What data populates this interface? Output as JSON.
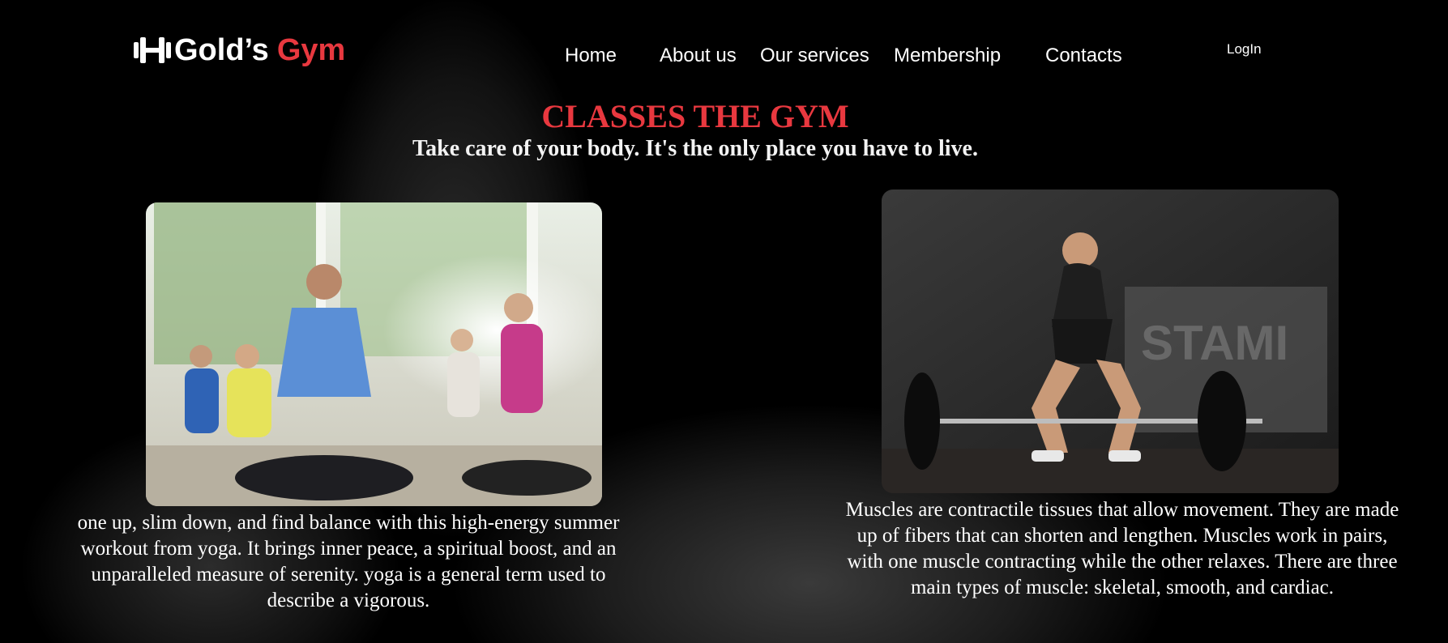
{
  "brand": {
    "name_part1": "Gold’s",
    "name_part2": "Gym",
    "icon": "dumbbell-icon",
    "accent_color": "#e8383f"
  },
  "nav": {
    "items": [
      {
        "label": "Home"
      },
      {
        "label": "About us"
      },
      {
        "label": "Our services"
      },
      {
        "label": "Membership"
      },
      {
        "label": "Contacts"
      }
    ],
    "login_label": "LogIn"
  },
  "hero": {
    "title": "CLASSES THE GYM",
    "subtitle": "Take care of your body. It's the only place you have to live."
  },
  "cards": [
    {
      "image": "yoga-class-photo",
      "text": "one up, slim down, and find balance with this high-energy summer workout from yoga. It brings inner peace, a spiritual boost, and an unparalleled measure of serenity. yoga is a general term used to describe a vigorous."
    },
    {
      "image": "deadlift-woman-photo",
      "text": "Muscles are contractile tissues that allow movement. They are made up of fibers that can shorten and lengthen. Muscles work in pairs, with one muscle contracting while the other relaxes. There are three main types of muscle: skeletal, smooth, and cardiac."
    }
  ]
}
